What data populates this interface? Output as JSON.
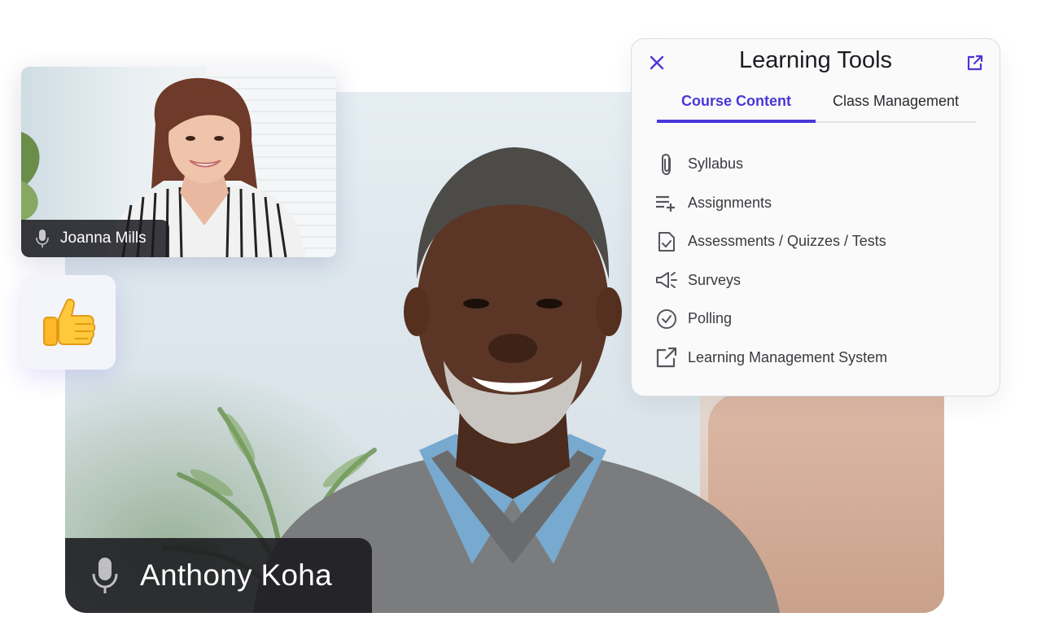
{
  "main_participant": {
    "name": "Anthony Koha"
  },
  "side_participant": {
    "name": "Joanna Mills"
  },
  "reaction": {
    "emoji": "👍"
  },
  "learning_tools": {
    "title": "Learning Tools",
    "accent": "#4b36d8",
    "tabs": [
      {
        "label": "Course Content",
        "active": true
      },
      {
        "label": "Class Management",
        "active": false
      }
    ],
    "items": [
      {
        "label": "Syllabus",
        "icon": "paperclip-icon"
      },
      {
        "label": "Assignments",
        "icon": "playlist-add-icon"
      },
      {
        "label": "Assessments / Quizzes / Tests",
        "icon": "document-check-icon"
      },
      {
        "label": "Surveys",
        "icon": "megaphone-icon"
      },
      {
        "label": "Polling",
        "icon": "check-circle-icon"
      },
      {
        "label": "Learning Management System",
        "icon": "external-link-icon"
      }
    ]
  }
}
